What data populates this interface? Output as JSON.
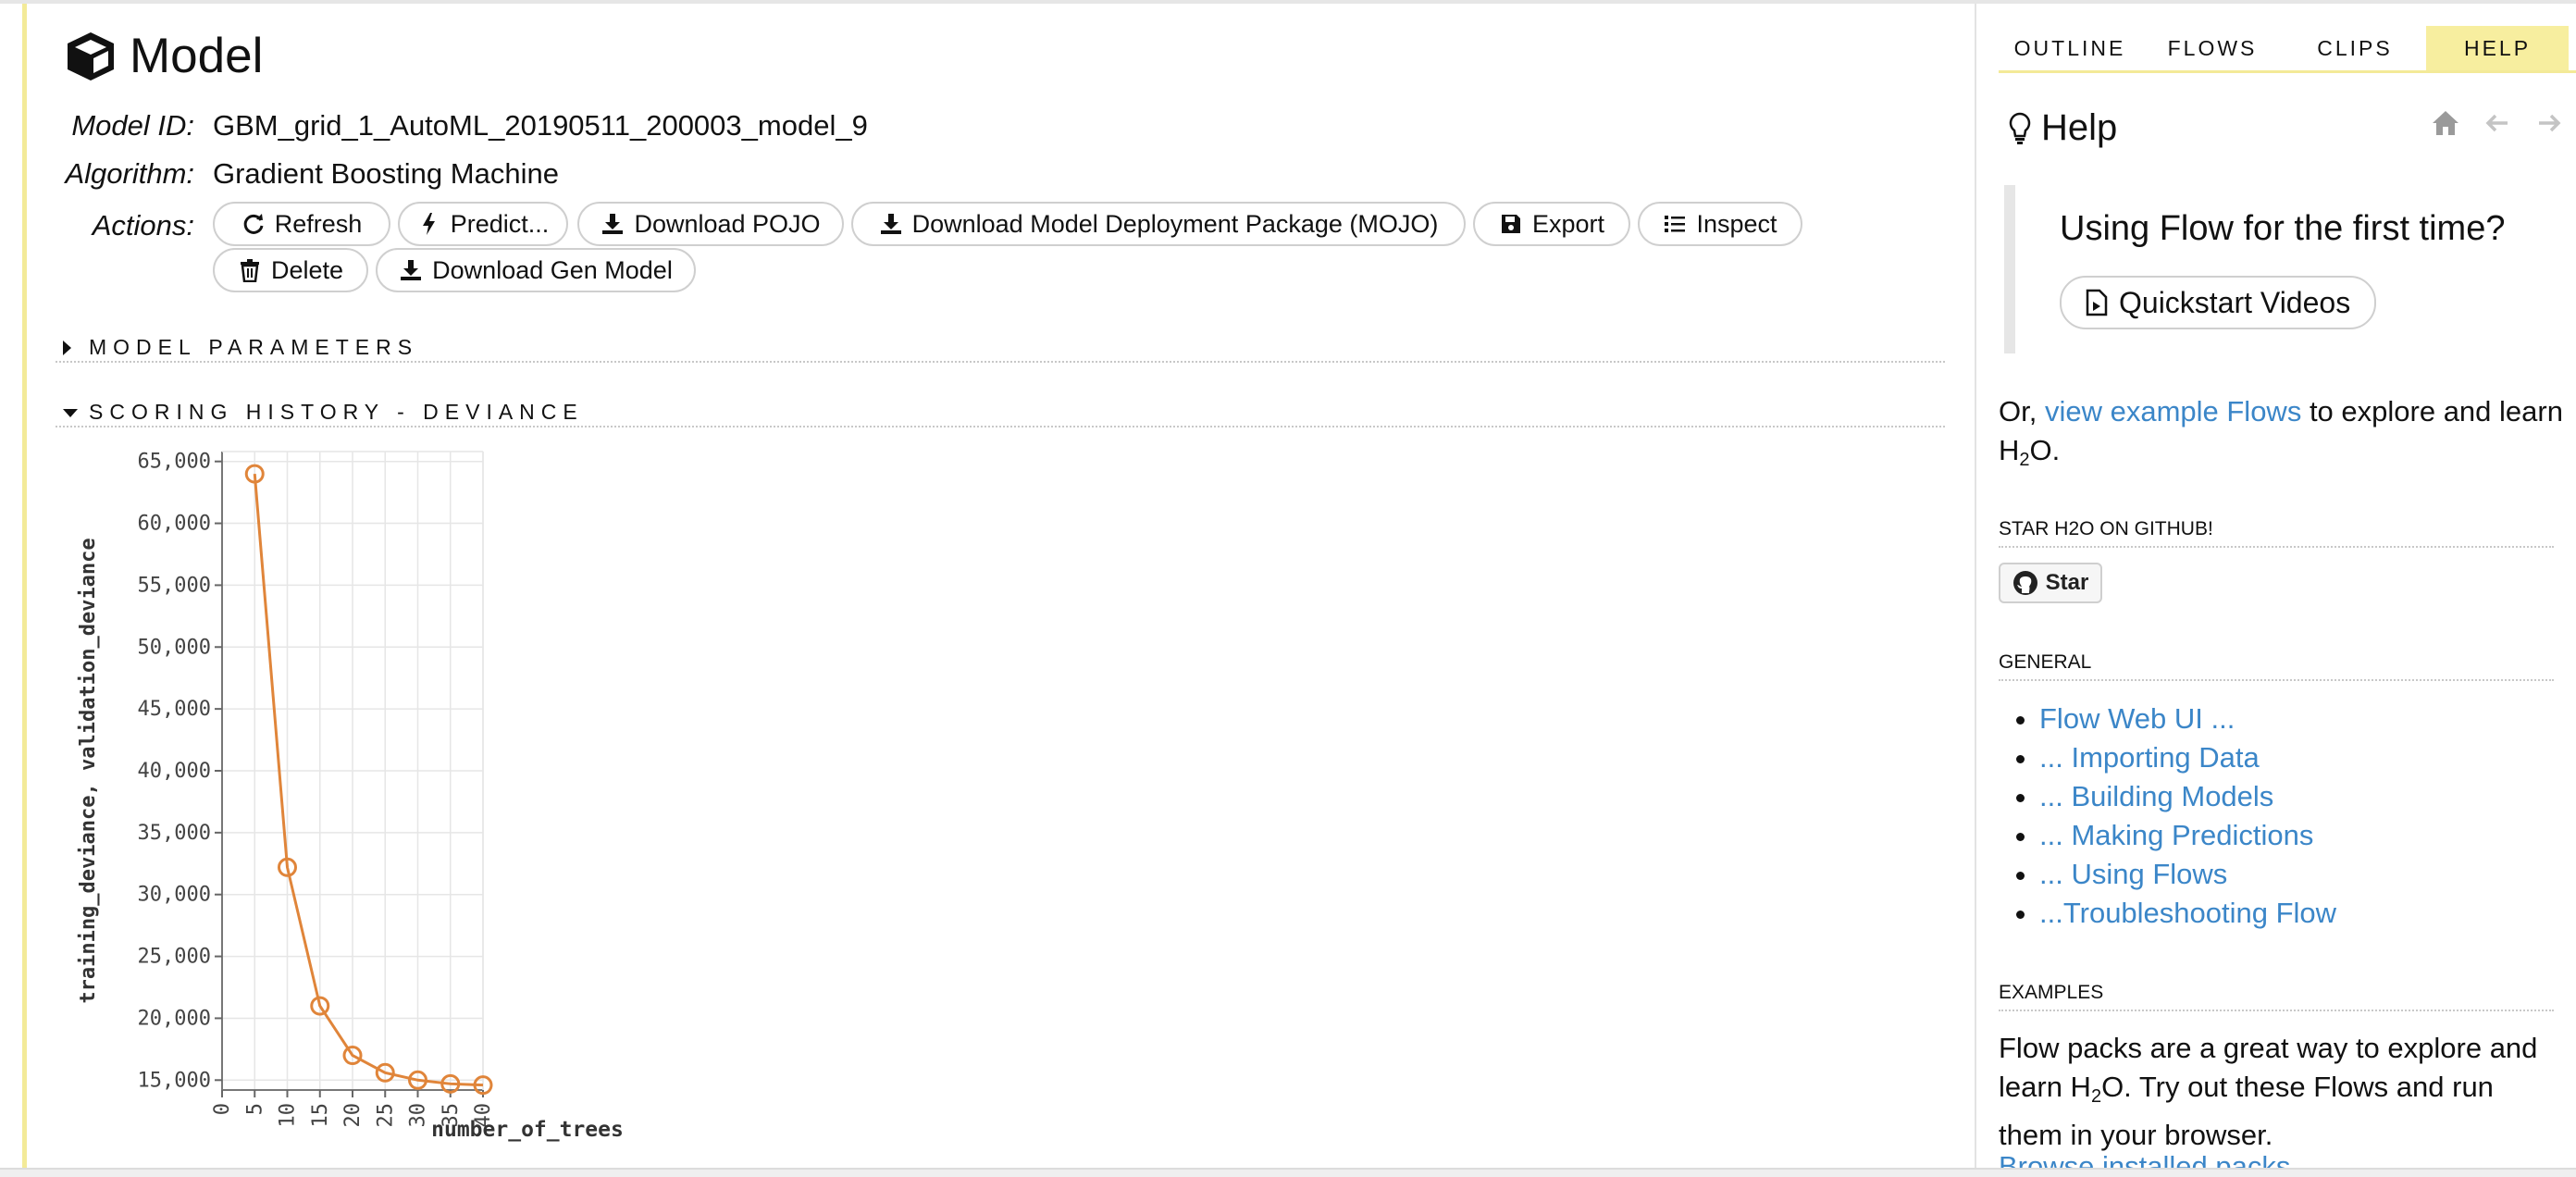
{
  "model": {
    "title": "Model",
    "labels": {
      "model_id": "Model ID:",
      "algorithm": "Algorithm:",
      "actions": "Actions:"
    },
    "model_id": "GBM_grid_1_AutoML_20190511_200003_model_9",
    "algorithm": "Gradient Boosting Machine",
    "actions": [
      {
        "label": "Refresh",
        "icon": "refresh-icon"
      },
      {
        "label": "Predict...",
        "icon": "bolt-icon"
      },
      {
        "label": "Download POJO",
        "icon": "download-icon"
      },
      {
        "label": "Download Model Deployment Package (MOJO)",
        "icon": "download-icon"
      },
      {
        "label": "Export",
        "icon": "save-icon"
      },
      {
        "label": "Inspect",
        "icon": "list-icon"
      },
      {
        "label": "Delete",
        "icon": "trash-icon"
      },
      {
        "label": "Download Gen Model",
        "icon": "download-icon"
      }
    ]
  },
  "sections": {
    "model_parameters": "MODEL PARAMETERS",
    "scoring_history": "SCORING HISTORY - DEVIANCE"
  },
  "chart_data": {
    "type": "line",
    "xlabel": "number_of_trees",
    "ylabel": "training_deviance, validation_deviance",
    "x_ticks": [
      0,
      5,
      10,
      15,
      20,
      25,
      30,
      35,
      40
    ],
    "y_ticks": [
      15000,
      20000,
      25000,
      30000,
      35000,
      40000,
      45000,
      50000,
      55000,
      60000,
      65000
    ],
    "y_tick_labels": [
      "15,000",
      "20,000",
      "25,000",
      "30,000",
      "35,000",
      "40,000",
      "45,000",
      "50,000",
      "55,000",
      "60,000",
      "65,000"
    ],
    "xlim": [
      0,
      40
    ],
    "ylim": [
      14200,
      65800
    ],
    "grid": true,
    "color": "#e0853a",
    "series": [
      {
        "x": [
          5,
          10,
          15,
          20,
          25,
          30,
          35,
          40
        ],
        "values": [
          64000,
          32200,
          21000,
          17000,
          15600,
          15000,
          14700,
          14600
        ]
      }
    ]
  },
  "sidebar": {
    "tabs": [
      {
        "label": "OUTLINE",
        "active": false
      },
      {
        "label": "FLOWS",
        "active": false
      },
      {
        "label": "CLIPS",
        "active": false
      },
      {
        "label": "HELP",
        "active": true
      }
    ],
    "help_title": "Help",
    "first_time": "Using Flow for the first time?",
    "quickstart": "Quickstart Videos",
    "or_text": "Or, ",
    "example_link": "view example Flows",
    "explore_text": " to explore and learn H",
    "subscript_2": "2",
    "o_dot": "O.",
    "star_section": "STAR H2O ON GITHUB!",
    "star_label": "Star",
    "general_section": "GENERAL",
    "general_links": [
      "Flow Web UI ...",
      "... Importing Data",
      "... Building Models",
      "... Making Predictions",
      "... Using Flows",
      "...Troubleshooting Flow"
    ],
    "examples_section": "EXAMPLES",
    "examples_text_1": "Flow packs are a great way to explore and learn H",
    "examples_text_2": "O. Try out these Flows and run them in your browser.",
    "browse_link": "Browse installed packs..."
  }
}
